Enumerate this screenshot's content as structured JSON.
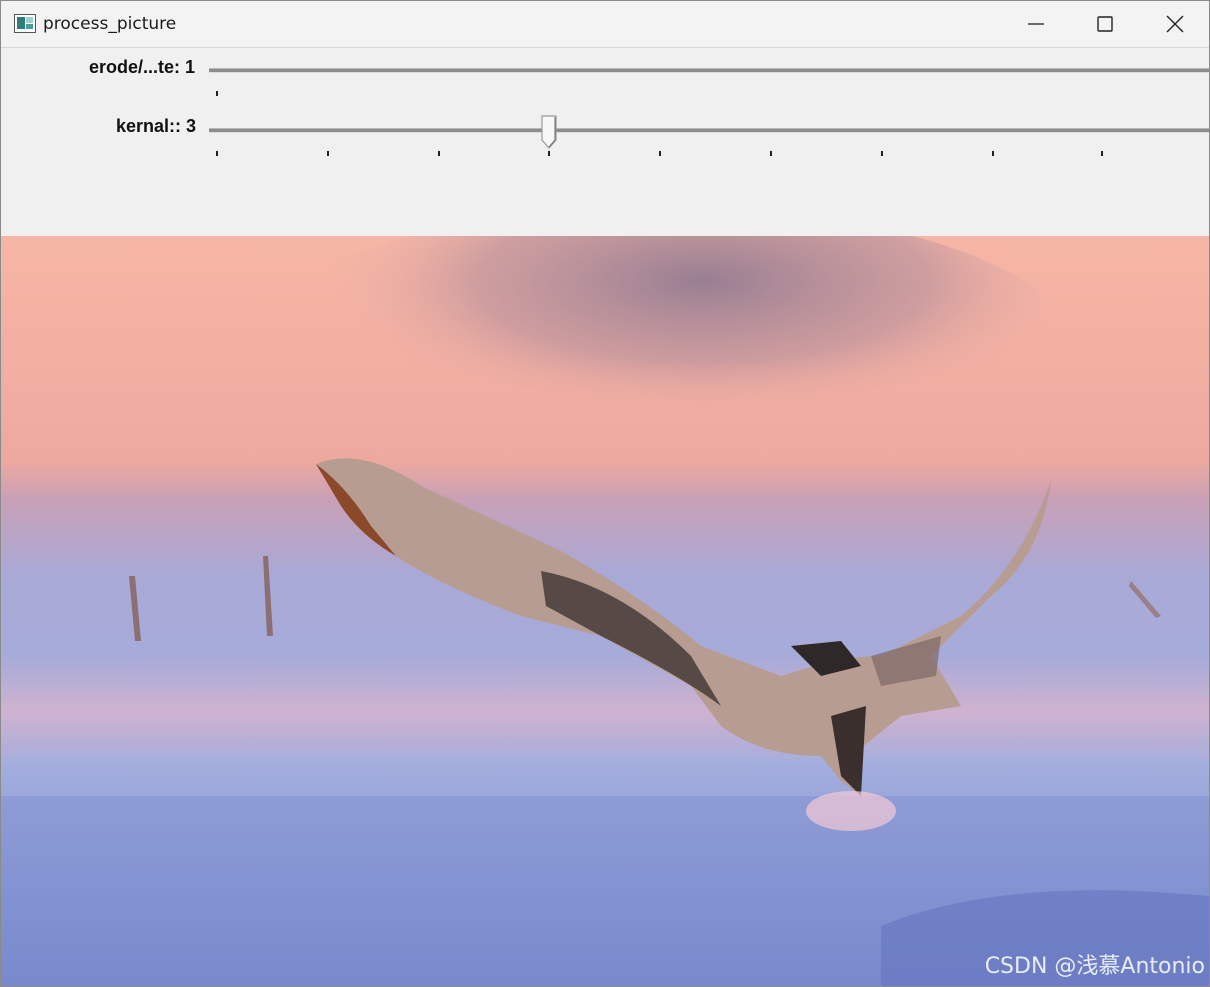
{
  "window": {
    "title": "process_picture",
    "icon": "app-window-icon",
    "buttons": [
      "minimize-icon",
      "maximize-icon",
      "close-icon"
    ]
  },
  "trackbars": [
    {
      "label": "erode/...te: 1",
      "value": 1,
      "min": 0,
      "max": 1
    },
    {
      "label": "kernal:: 3",
      "value": 3,
      "min": 0,
      "max": 9
    }
  ],
  "image": {
    "subject": "hawk-in-flight",
    "colors": {
      "sky": "#f4b5a6",
      "haze": "#9a7f93",
      "snow": "#9ea7d8",
      "snow_dark": "#6d7cc0"
    }
  },
  "watermark": "CSDN @浅慕Antonio"
}
